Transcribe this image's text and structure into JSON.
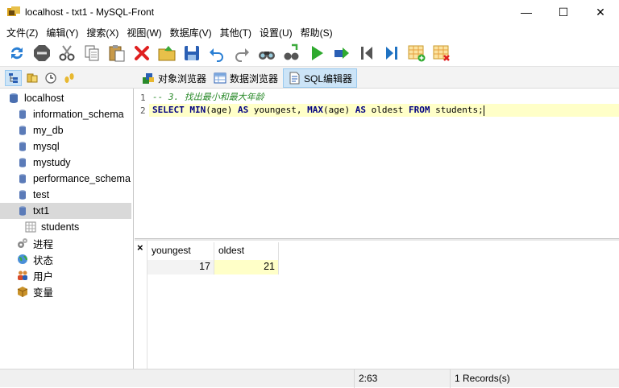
{
  "window": {
    "title": "localhost - txt1 - MySQL-Front",
    "minimize": "—",
    "maximize": "☐",
    "close": "✕"
  },
  "menu": [
    "文件(Z)",
    "编辑(Y)",
    "搜索(X)",
    "视图(W)",
    "数据库(V)",
    "其他(T)",
    "设置(U)",
    "帮助(S)"
  ],
  "toolbar": [
    "refresh-icon",
    "stop-icon",
    "cut-icon",
    "copy-icon",
    "paste-icon",
    "delete-icon",
    "open-icon",
    "save-icon",
    "undo-icon",
    "redo-icon",
    "find-icon",
    "replace-icon",
    "run-icon",
    "run-selection-icon",
    "first-icon",
    "last-icon",
    "insert-record-icon",
    "delete-record-icon"
  ],
  "tabs": {
    "object_browser": "对象浏览器",
    "data_browser": "数据浏览器",
    "sql_editor": "SQL编辑器"
  },
  "tree": {
    "root": "localhost",
    "databases": [
      "information_schema",
      "my_db",
      "mysql",
      "mystudy",
      "performance_schema",
      "test",
      "txt1"
    ],
    "tables": [
      "students"
    ],
    "extras": [
      "进程",
      "状态",
      "用户",
      "变量"
    ]
  },
  "editor": {
    "line_numbers": [
      "1",
      "2"
    ],
    "line1": "-- 3. 找出最小和最大年龄",
    "l2": {
      "k1": "SELECT",
      "f1": "MIN",
      "a1": "(age)",
      "k2": "AS",
      "i1": "youngest,",
      "f2": "MAX",
      "a2": "(age)",
      "k3": "AS",
      "i2": "oldest",
      "k4": "FROM",
      "i3": "students;"
    }
  },
  "results": {
    "close": "×",
    "columns": [
      "youngest",
      "oldest"
    ],
    "row": [
      "17",
      "21"
    ]
  },
  "status": {
    "position": "2:63",
    "records": "1 Records(s)"
  },
  "colors": {
    "selection": "#cce4f7",
    "current_line": "#ffffc8",
    "comment": "#2a8a2a",
    "keyword": "#000080"
  }
}
